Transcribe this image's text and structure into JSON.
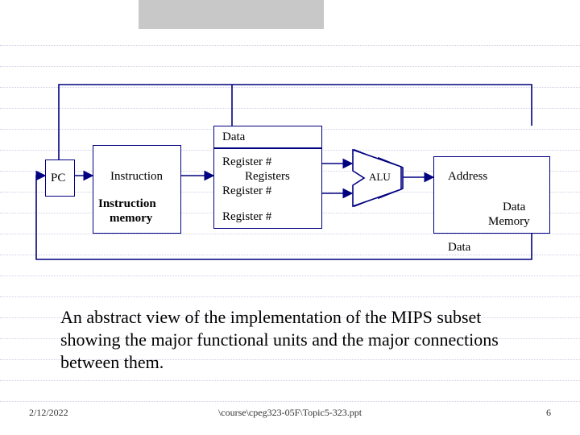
{
  "diagram": {
    "blocks": {
      "pc": "PC",
      "instruction_top": "Instruction",
      "instruction_mem_l1": "Instruction",
      "instruction_mem_l2": "memory",
      "registers_box": {
        "top_port": "Register #",
        "center": "Registers",
        "mid_port": "Register #",
        "bottom_port": "Register #"
      },
      "data_top": "Data",
      "alu": "ALU",
      "address": "Address",
      "data_memory_l1": "Data",
      "data_memory_l2": "Memory",
      "data_bottom": "Data"
    }
  },
  "caption": "An abstract view of the implementation of the MIPS subset showing the major functional units and the major connections between them.",
  "footer": {
    "date": "2/12/2022",
    "path": "\\course\\cpeg323-05F\\Topic5-323.ppt",
    "page": 6
  }
}
